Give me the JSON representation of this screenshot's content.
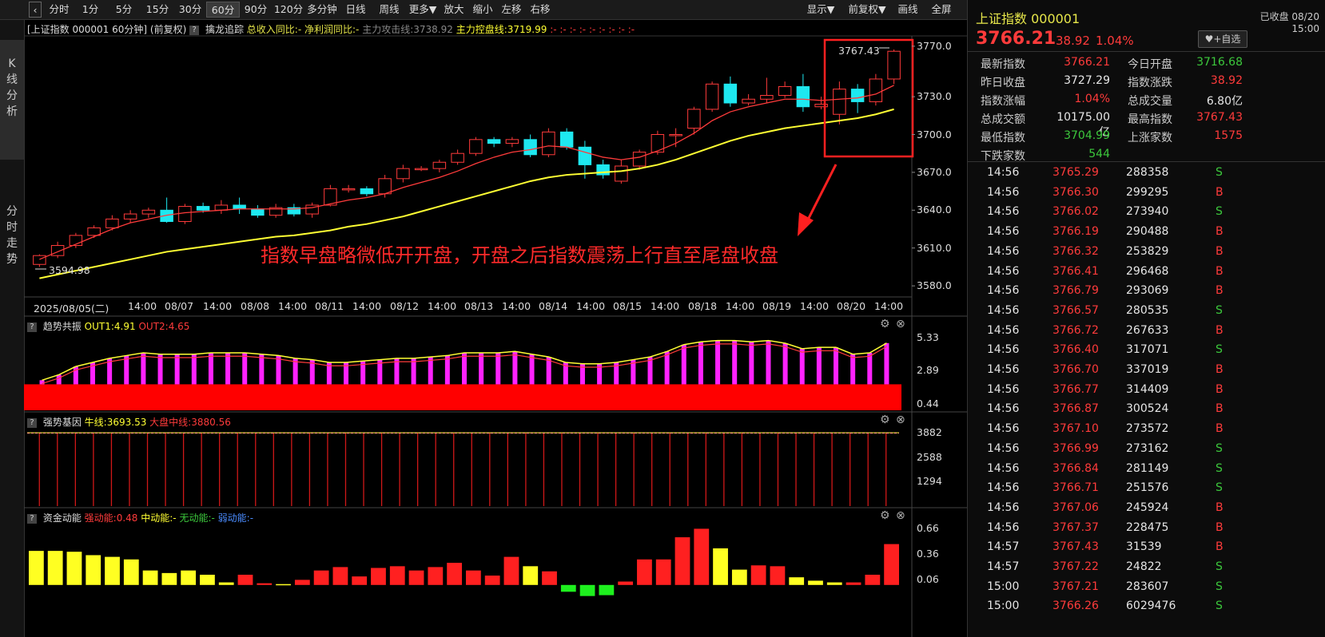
{
  "toolbar": {
    "back_icon": "chevron-left-icon",
    "periods": [
      "分时",
      "1分",
      "5分",
      "15分",
      "30分",
      "60分",
      "90分",
      "120分",
      "多分钟",
      "日线",
      "周线",
      "更多▼",
      "放大",
      "缩小",
      "左移",
      "右移"
    ],
    "active_period": "60分",
    "right_buttons": [
      "显示▼",
      "前复权▼",
      "画线",
      "全屏"
    ]
  },
  "leftnav": {
    "kline": "K线分析",
    "fenshi": "分时走势"
  },
  "chart_header": {
    "title": "[上证指数 000001 60分钟]",
    "adjust": "(前复权)",
    "indicator": "擒龙追踪",
    "item1": "总收入同比:-",
    "item2": "净利润同比:-",
    "item3": "主力攻击线:3738.92",
    "item4": "主力控盘线:3719.99",
    "dots": ":- :- :- :- :- :- :- :- :-"
  },
  "annotation": {
    "text": "指数早盘略微低开开盘，开盘之后指数震荡上行直至尾盘收盘",
    "high_label": "3767.43",
    "low_label": "3594.98"
  },
  "pane1": {
    "name": "趋势共振",
    "out1": "OUT1:4.91",
    "out2": "OUT2:4.65"
  },
  "pane2": {
    "name": "强势基因",
    "niu": "牛线:3693.53",
    "dapan": "大盘中线:3880.56"
  },
  "pane3": {
    "name": "资金动能",
    "strong": "强动能:0.48",
    "mid": "中动能:-",
    "none": "无动能:-",
    "weak": "弱动能:-"
  },
  "chart_data": [
    {
      "type": "candlestick",
      "title": "上证指数 000001 60分钟",
      "x": [
        "2025/08/05(二)",
        "14:00",
        "08/07",
        "14:00",
        "08/08",
        "14:00",
        "08/11",
        "14:00",
        "08/12",
        "14:00",
        "08/13",
        "14:00",
        "08/14",
        "14:00",
        "08/15",
        "14:00",
        "08/18",
        "14:00",
        "08/19",
        "14:00",
        "08/20",
        "14:00"
      ],
      "yticks": [
        "3770.0",
        "3730.0",
        "3700.0",
        "3670.0",
        "3640.0",
        "3610.0",
        "3580.0"
      ],
      "ylim": [
        3575,
        3775
      ],
      "candles": [
        [
          3597,
          3604,
          3595,
          3605
        ],
        [
          3604,
          3612,
          3602,
          3615
        ],
        [
          3612,
          3620,
          3610,
          3622
        ],
        [
          3620,
          3626,
          3618,
          3628
        ],
        [
          3626,
          3633,
          3624,
          3636
        ],
        [
          3633,
          3637,
          3630,
          3640
        ],
        [
          3637,
          3640,
          3634,
          3642
        ],
        [
          3640,
          3631,
          3630,
          3650
        ],
        [
          3631,
          3643,
          3629,
          3645
        ],
        [
          3643,
          3640,
          3638,
          3646
        ],
        [
          3640,
          3644,
          3637,
          3648
        ],
        [
          3644,
          3641,
          3637,
          3650
        ],
        [
          3641,
          3636,
          3634,
          3644
        ],
        [
          3636,
          3642,
          3634,
          3645
        ],
        [
          3642,
          3637,
          3635,
          3645
        ],
        [
          3637,
          3644,
          3634,
          3646
        ],
        [
          3644,
          3657,
          3643,
          3660
        ],
        [
          3657,
          3657,
          3654,
          3660
        ],
        [
          3657,
          3653,
          3651,
          3659
        ],
        [
          3653,
          3665,
          3650,
          3668
        ],
        [
          3665,
          3673,
          3662,
          3676
        ],
        [
          3673,
          3673,
          3671,
          3675
        ],
        [
          3673,
          3678,
          3670,
          3680
        ],
        [
          3678,
          3685,
          3676,
          3688
        ],
        [
          3685,
          3696,
          3683,
          3698
        ],
        [
          3696,
          3693,
          3690,
          3698
        ],
        [
          3693,
          3696,
          3690,
          3698
        ],
        [
          3696,
          3684,
          3682,
          3700
        ],
        [
          3684,
          3702,
          3682,
          3705
        ],
        [
          3702,
          3690,
          3688,
          3705
        ],
        [
          3690,
          3676,
          3665,
          3695
        ],
        [
          3676,
          3668,
          3665,
          3680
        ],
        [
          3663,
          3675,
          3661,
          3680
        ],
        [
          3675,
          3686,
          3672,
          3688
        ],
        [
          3686,
          3700,
          3684,
          3703
        ],
        [
          3700,
          3700,
          3690,
          3705
        ],
        [
          3705,
          3720,
          3700,
          3722
        ],
        [
          3720,
          3740,
          3718,
          3742
        ],
        [
          3740,
          3725,
          3722,
          3746
        ],
        [
          3725,
          3728,
          3723,
          3732
        ],
        [
          3728,
          3731,
          3725,
          3745
        ],
        [
          3731,
          3738,
          3729,
          3742
        ],
        [
          3738,
          3722,
          3718,
          3748
        ],
        [
          3722,
          3724,
          3720,
          3730
        ],
        [
          3716,
          3736,
          3708,
          3742
        ],
        [
          3736,
          3726,
          3717,
          3740
        ],
        [
          3726,
          3744,
          3723,
          3748
        ],
        [
          3744,
          3766,
          3740,
          3767.43
        ]
      ],
      "series": [
        {
          "name": "主力攻击线",
          "color": "#ff3b3b",
          "values": [
            3601,
            3607,
            3613,
            3619,
            3625,
            3630,
            3633,
            3636,
            3638,
            3639,
            3640,
            3641,
            3641,
            3641,
            3641,
            3642,
            3645,
            3648,
            3650,
            3653,
            3658,
            3662,
            3666,
            3671,
            3677,
            3682,
            3686,
            3688,
            3691,
            3690,
            3686,
            3682,
            3680,
            3682,
            3687,
            3693,
            3701,
            3711,
            3718,
            3722,
            3725,
            3728,
            3728,
            3727,
            3728,
            3729,
            3732,
            3739
          ]
        },
        {
          "name": "主力控盘线",
          "color": "#ffff33",
          "values": [
            3586,
            3589,
            3592,
            3595,
            3598,
            3601,
            3604,
            3607,
            3609,
            3611,
            3613,
            3615,
            3617,
            3619,
            3620,
            3622,
            3624,
            3627,
            3629,
            3632,
            3635,
            3639,
            3643,
            3647,
            3651,
            3655,
            3659,
            3663,
            3666,
            3668,
            3669,
            3670,
            3671,
            3673,
            3676,
            3680,
            3685,
            3690,
            3695,
            3699,
            3702,
            3705,
            3707,
            3709,
            3711,
            3713,
            3716,
            3720
          ]
        }
      ]
    },
    {
      "type": "bar",
      "title": "趋势共振",
      "yticks": [
        "5.33",
        "2.89",
        "0.44"
      ],
      "ylim": [
        0,
        5.6
      ],
      "values": [
        2.2,
        2.6,
        3.2,
        3.5,
        3.8,
        4.0,
        4.2,
        4.1,
        4.1,
        4.1,
        4.2,
        4.2,
        4.2,
        4.1,
        4.0,
        3.8,
        3.7,
        3.5,
        3.5,
        3.6,
        3.7,
        3.8,
        3.8,
        3.9,
        4.0,
        4.2,
        4.2,
        4.2,
        4.3,
        4.1,
        3.9,
        3.5,
        3.4,
        3.4,
        3.5,
        3.7,
        3.9,
        4.3,
        4.8,
        5.0,
        5.1,
        5.1,
        5.0,
        5.1,
        4.9,
        4.5,
        4.6,
        4.6,
        4.1,
        4.2,
        4.91
      ],
      "base": 1.9
    },
    {
      "type": "bar",
      "title": "强势基因",
      "yticks": [
        "3882",
        "2588",
        "1294"
      ],
      "ylim": [
        0,
        4140
      ],
      "values": [
        3880,
        3880,
        3880,
        3880,
        3880,
        3880,
        3880,
        3880,
        3880,
        3880,
        3880,
        3880,
        3880,
        3880,
        3880,
        3880,
        3880,
        3880,
        3880,
        3880,
        3880,
        3880,
        3880,
        3880,
        3880,
        3880,
        3880,
        3880,
        3880,
        3880,
        3880,
        3880,
        3880,
        3880,
        3880,
        3880,
        3880,
        3880,
        3880,
        3880,
        3880,
        3880,
        3880,
        3880,
        3880,
        3880,
        3880,
        3880
      ]
    },
    {
      "type": "bar",
      "title": "资金动能",
      "yticks": [
        "0.66",
        "0.36",
        "0.06"
      ],
      "ylim": [
        -0.18,
        0.72
      ],
      "values": [
        0.4,
        0.4,
        0.39,
        0.35,
        0.33,
        0.3,
        0.17,
        0.14,
        0.17,
        0.12,
        0.03,
        0.12,
        0.02,
        0.01,
        0.06,
        0.17,
        0.21,
        0.1,
        0.2,
        0.22,
        0.17,
        0.21,
        0.26,
        0.17,
        0.11,
        0.33,
        0.22,
        0.16,
        -0.08,
        -0.13,
        -0.12,
        0.04,
        0.3,
        0.3,
        0.56,
        0.66,
        0.43,
        0.18,
        0.23,
        0.22,
        0.09,
        0.05,
        0.03,
        0.03,
        0.12,
        0.48
      ],
      "colors_rule": "yellow=declining strength, red=rising, green=negative"
    }
  ],
  "quote": {
    "name": "上证指数 000001",
    "status": "已收盘 08/20 15:00",
    "price": "3766.21",
    "change": "38.92",
    "pct": "1.04%",
    "add_button": "+自选",
    "heart_icon": "heart-icon",
    "fields": [
      {
        "label": "最新指数",
        "value": "3766.21",
        "color": "red"
      },
      {
        "label": "今日开盘",
        "value": "3716.68",
        "color": "green"
      },
      {
        "label": "昨日收盘",
        "value": "3727.29",
        "color": "white"
      },
      {
        "label": "指数涨跌",
        "value": "38.92",
        "color": "red"
      },
      {
        "label": "指数涨幅",
        "value": "1.04%",
        "color": "red"
      },
      {
        "label": "总成交量",
        "value": "6.80亿",
        "color": "white"
      },
      {
        "label": "总成交额",
        "value": "10175.00亿",
        "color": "white"
      },
      {
        "label": "最高指数",
        "value": "3767.43",
        "color": "red"
      },
      {
        "label": "最低指数",
        "value": "3704.99",
        "color": "green"
      },
      {
        "label": "上涨家数",
        "value": "1575",
        "color": "red"
      },
      {
        "label": "下跌家数",
        "value": "544",
        "color": "green"
      }
    ],
    "ticks": [
      [
        "14:56",
        "3765.29",
        "288358",
        "S"
      ],
      [
        "14:56",
        "3766.30",
        "299295",
        "B"
      ],
      [
        "14:56",
        "3766.02",
        "273940",
        "S"
      ],
      [
        "14:56",
        "3766.19",
        "290488",
        "B"
      ],
      [
        "14:56",
        "3766.32",
        "253829",
        "B"
      ],
      [
        "14:56",
        "3766.41",
        "296468",
        "B"
      ],
      [
        "14:56",
        "3766.79",
        "293069",
        "B"
      ],
      [
        "14:56",
        "3766.57",
        "280535",
        "S"
      ],
      [
        "14:56",
        "3766.72",
        "267633",
        "B"
      ],
      [
        "14:56",
        "3766.40",
        "317071",
        "S"
      ],
      [
        "14:56",
        "3766.70",
        "337019",
        "B"
      ],
      [
        "14:56",
        "3766.77",
        "314409",
        "B"
      ],
      [
        "14:56",
        "3766.87",
        "300524",
        "B"
      ],
      [
        "14:56",
        "3767.10",
        "273572",
        "B"
      ],
      [
        "14:56",
        "3766.99",
        "273162",
        "S"
      ],
      [
        "14:56",
        "3766.84",
        "281149",
        "S"
      ],
      [
        "14:56",
        "3766.71",
        "251576",
        "S"
      ],
      [
        "14:56",
        "3767.06",
        "245924",
        "B"
      ],
      [
        "14:56",
        "3767.37",
        "228475",
        "B"
      ],
      [
        "14:57",
        "3767.43",
        "31539",
        "B"
      ],
      [
        "14:57",
        "3767.22",
        "24822",
        "S"
      ],
      [
        "15:00",
        "3767.21",
        "283607",
        "S"
      ],
      [
        "15:00",
        "3766.26",
        "6029476",
        "S"
      ]
    ]
  }
}
